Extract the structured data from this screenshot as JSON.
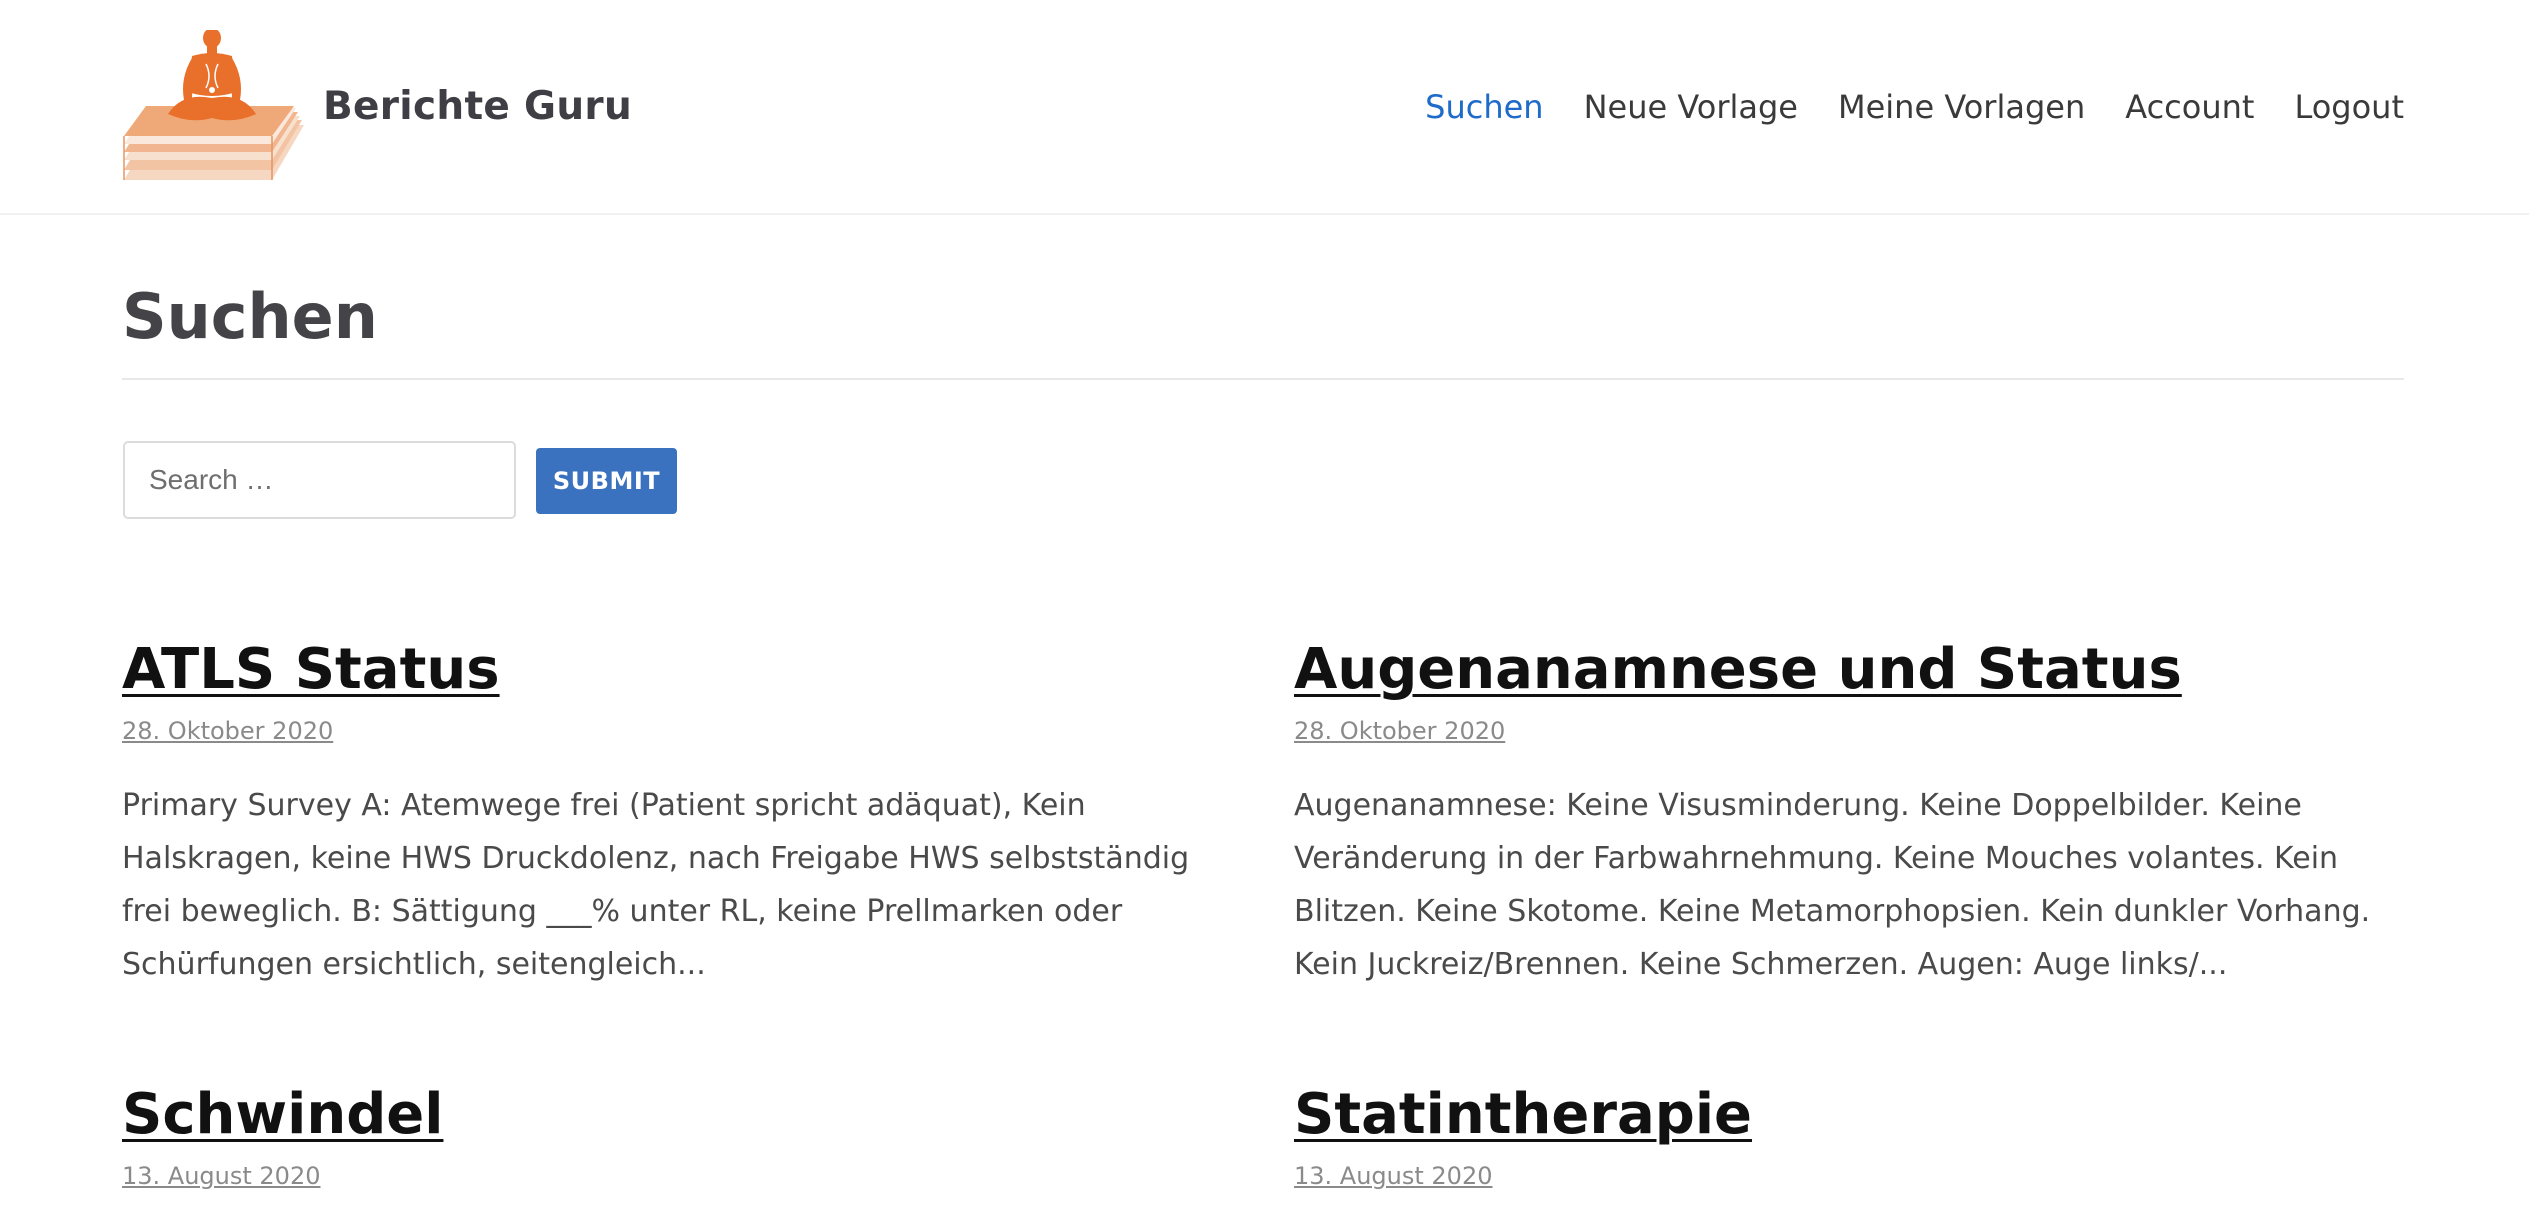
{
  "site": {
    "title": "Berichte Guru",
    "logo_icon": "meditating-figure-on-papers-logo",
    "accent_color": "#e8702a"
  },
  "nav": {
    "items": [
      {
        "label": "Suchen",
        "active": true
      },
      {
        "label": "Neue Vorlage",
        "active": false
      },
      {
        "label": "Meine Vorlagen",
        "active": false
      },
      {
        "label": "Account",
        "active": false
      },
      {
        "label": "Logout",
        "active": false
      }
    ],
    "active_color": "#1f6bc9"
  },
  "page": {
    "title": "Suchen"
  },
  "search": {
    "placeholder": "Search …",
    "value": "",
    "submit_label": "SUBMIT",
    "button_color": "#3a72bf"
  },
  "posts": [
    {
      "title": "ATLS Status",
      "date": "28. Oktober 2020",
      "excerpt": "Primary Survey A: Atemwege frei (Patient spricht adäquat), Kein Halskragen, keine HWS Druckdolenz, nach Freigabe HWS selbstständig frei beweglich. B: Sättigung ___% unter RL, keine Prellmarken oder Schürfungen ersichtlich, seitengleich..."
    },
    {
      "title": "Augenanamnese und Status",
      "date": "28. Oktober 2020",
      "excerpt": "Augenanamnese: Keine Visusminderung. Keine Doppelbilder. Keine Veränderung in der Farbwahrnehmung. Keine Mouches volantes. Kein Blitzen. Keine Skotome. Keine Metamorphopsien. Kein dunkler Vorhang. Kein Juckreiz/Brennen. Keine Schmerzen.   Augen: Auge links/..."
    },
    {
      "title": "Schwindel",
      "date": "13. August 2020",
      "excerpt": ""
    },
    {
      "title": "Statintherapie",
      "date": "13. August 2020",
      "excerpt": ""
    }
  ]
}
